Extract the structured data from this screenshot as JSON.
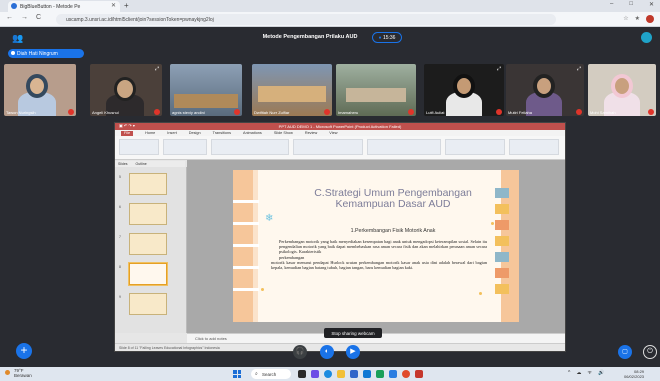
{
  "browser": {
    "tab_title": "BigBlueButton - Metode Pe",
    "tab_close": "✕",
    "new_tab": "+",
    "url": "uscamp.3.unsri.ac.id/html5client/join?sessionToken=pwnaykjng2loj",
    "nav_icons": [
      "←",
      "→",
      "C"
    ],
    "window_controls": [
      "–",
      "□",
      "✕"
    ],
    "extensions": [
      "☆",
      "★"
    ]
  },
  "meeting": {
    "title": "Metode Pengembangan Prilaku AUD",
    "timer": "15:36",
    "host_chip": "Diah Hati Ningrum",
    "participants": [
      {
        "name": "Tawon Nuringsih",
        "bg": "#a38b7a"
      },
      {
        "name": "Angeli Khusnul",
        "bg": "#5a4d45"
      },
      {
        "name": "agnis steviy andini",
        "bg": "#6e7a88"
      },
      {
        "name": "Dwifitah Nurr Zulfiar",
        "bg": "#8a6a4a"
      },
      {
        "name": "Imamaheru",
        "bg": "#6f7a69"
      },
      {
        "name": "Lutfi Auliat",
        "bg": "#2c2c2c"
      },
      {
        "name": "Mutiri Feliaha",
        "bg": "#3e3a3a"
      },
      {
        "name": "Mohi Samihah",
        "bg": "#cfc8bd"
      }
    ],
    "stop_share": "Stop sharing webcam"
  },
  "ppt": {
    "title_bar": "PPT AUD DEMO 1 - Microsoft PowerPoint (Product Activation Failed)",
    "menu": [
      "File",
      "Home",
      "Insert",
      "Design",
      "Transitions",
      "Animations",
      "Slide Show",
      "Review",
      "View"
    ],
    "panel_tabs": [
      "Slides",
      "Outline"
    ],
    "notes_placeholder": "Click to add notes",
    "status": "Slide 8 of 11   \"Falling Leaves Educational Infographics\"   Indonesia",
    "slide": {
      "title": "C.Strategi Umum Pengembangan Kemampuan Dasar AUD",
      "subtitle": "1.Perkembangan Fisik Motorik Anak",
      "body": [
        "Perkembangan motorik yang baik menyediakan kesempatan bagi anak untuk mengadopsi keterampilan sosial. Selain itu pengendalian motorik yang baik dapat membebaskan rasa aman secara fisik dan akan melahirkan perasaan aman secara psikologis. Karakteristik",
        "perkembangan",
        "motorik kasar menurut pendapat Hurlock urutan perkembangan motorik kasar anak usia dini adalah berawal dari bagian kepala, kemudian bagian batang tubuh, bagian tangan, baru kemudian bagian kaki."
      ]
    }
  },
  "taskbar": {
    "weather_temp": "79°F",
    "weather_desc": "Berawan",
    "search": "Search",
    "tray": [
      "^",
      "☁",
      "ᯤ",
      "🔊"
    ],
    "time": "08:29",
    "date": "06/02/2023"
  },
  "colors": {
    "accent": "#1a73e8",
    "danger": "#e0342a",
    "ppt_title": "#c0504d"
  }
}
